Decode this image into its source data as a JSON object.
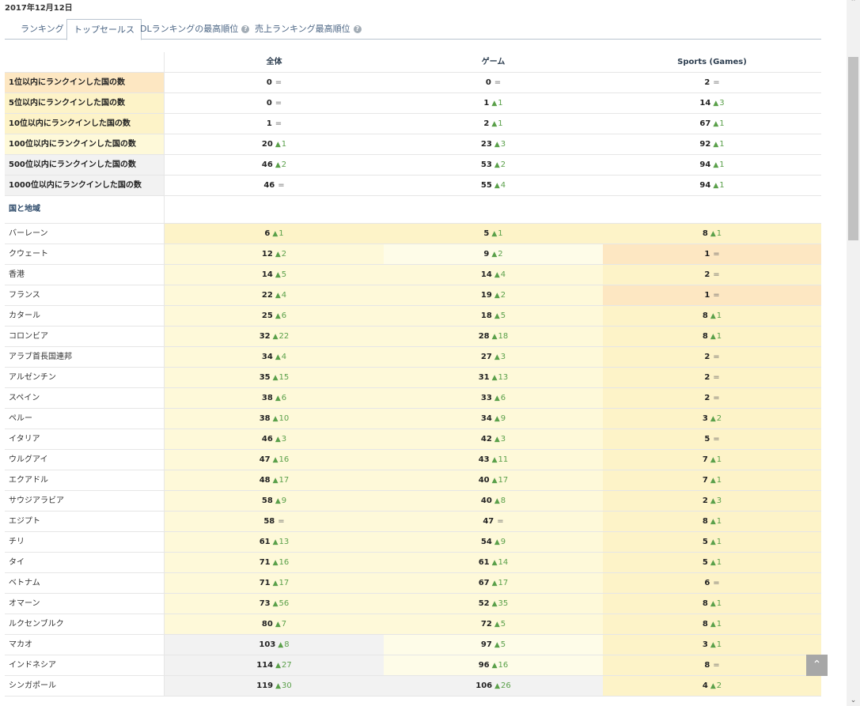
{
  "date": "2017年12月12日",
  "tabs": [
    {
      "label": "ランキング",
      "help": false,
      "active": false
    },
    {
      "label": "トップセールス",
      "help": false,
      "active": true
    },
    {
      "label": "DLランキングの最高順位",
      "help": true,
      "active": false
    },
    {
      "label": "売上ランキング最高順位",
      "help": true,
      "active": false
    }
  ],
  "columns": [
    "全体",
    "ゲーム",
    "Sports (Games)"
  ],
  "summary": [
    {
      "label": "1位以内にランクインした国の数",
      "cells": [
        [
          "0",
          "="
        ],
        [
          "0",
          "="
        ],
        [
          "2",
          "="
        ]
      ]
    },
    {
      "label": "5位以内にランクインした国の数",
      "cells": [
        [
          "0",
          "="
        ],
        [
          "1",
          "1"
        ],
        [
          "14",
          "3"
        ]
      ]
    },
    {
      "label": "10位以内にランクインした国の数",
      "cells": [
        [
          "1",
          "="
        ],
        [
          "2",
          "1"
        ],
        [
          "67",
          "1"
        ]
      ]
    },
    {
      "label": "100位以内にランクインした国の数",
      "cells": [
        [
          "20",
          "1"
        ],
        [
          "23",
          "3"
        ],
        [
          "92",
          "1"
        ]
      ]
    },
    {
      "label": "500位以内にランクインした国の数",
      "cells": [
        [
          "46",
          "2"
        ],
        [
          "53",
          "2"
        ],
        [
          "94",
          "1"
        ]
      ]
    },
    {
      "label": "1000位以内にランクインした国の数",
      "cells": [
        [
          "46",
          "="
        ],
        [
          "55",
          "4"
        ],
        [
          "94",
          "1"
        ]
      ]
    }
  ],
  "section_title": "国と地域",
  "countries": [
    {
      "name": "バーレーン",
      "cells": [
        [
          "6",
          "1"
        ],
        [
          "5",
          "1"
        ],
        [
          "8",
          "1"
        ]
      ]
    },
    {
      "name": "クウェート",
      "cells": [
        [
          "12",
          "2"
        ],
        [
          "9",
          "2"
        ],
        [
          "1",
          "="
        ]
      ]
    },
    {
      "name": "香港",
      "cells": [
        [
          "14",
          "5"
        ],
        [
          "14",
          "4"
        ],
        [
          "2",
          "="
        ]
      ]
    },
    {
      "name": "フランス",
      "cells": [
        [
          "22",
          "4"
        ],
        [
          "19",
          "2"
        ],
        [
          "1",
          "="
        ]
      ]
    },
    {
      "name": "カタール",
      "cells": [
        [
          "25",
          "6"
        ],
        [
          "18",
          "5"
        ],
        [
          "8",
          "1"
        ]
      ]
    },
    {
      "name": "コロンビア",
      "cells": [
        [
          "32",
          "22"
        ],
        [
          "28",
          "18"
        ],
        [
          "8",
          "1"
        ]
      ]
    },
    {
      "name": "アラブ首長国連邦",
      "cells": [
        [
          "34",
          "4"
        ],
        [
          "27",
          "3"
        ],
        [
          "2",
          "="
        ]
      ]
    },
    {
      "name": "アルゼンチン",
      "cells": [
        [
          "35",
          "15"
        ],
        [
          "31",
          "13"
        ],
        [
          "2",
          "="
        ]
      ]
    },
    {
      "name": "スペイン",
      "cells": [
        [
          "38",
          "6"
        ],
        [
          "33",
          "6"
        ],
        [
          "2",
          "="
        ]
      ]
    },
    {
      "name": "ペルー",
      "cells": [
        [
          "38",
          "10"
        ],
        [
          "34",
          "9"
        ],
        [
          "3",
          "2"
        ]
      ]
    },
    {
      "name": "イタリア",
      "cells": [
        [
          "46",
          "3"
        ],
        [
          "42",
          "3"
        ],
        [
          "5",
          "="
        ]
      ]
    },
    {
      "name": "ウルグアイ",
      "cells": [
        [
          "47",
          "16"
        ],
        [
          "43",
          "11"
        ],
        [
          "7",
          "1"
        ]
      ]
    },
    {
      "name": "エクアドル",
      "cells": [
        [
          "48",
          "17"
        ],
        [
          "40",
          "17"
        ],
        [
          "7",
          "1"
        ]
      ]
    },
    {
      "name": "サウジアラビア",
      "cells": [
        [
          "58",
          "9"
        ],
        [
          "40",
          "8"
        ],
        [
          "2",
          "3"
        ]
      ]
    },
    {
      "name": "エジプト",
      "cells": [
        [
          "58",
          "="
        ],
        [
          "47",
          "="
        ],
        [
          "8",
          "1"
        ]
      ]
    },
    {
      "name": "チリ",
      "cells": [
        [
          "61",
          "13"
        ],
        [
          "54",
          "9"
        ],
        [
          "5",
          "1"
        ]
      ]
    },
    {
      "name": "タイ",
      "cells": [
        [
          "71",
          "16"
        ],
        [
          "61",
          "14"
        ],
        [
          "5",
          "1"
        ]
      ]
    },
    {
      "name": "ベトナム",
      "cells": [
        [
          "71",
          "17"
        ],
        [
          "67",
          "17"
        ],
        [
          "6",
          "="
        ]
      ]
    },
    {
      "name": "オマーン",
      "cells": [
        [
          "73",
          "56"
        ],
        [
          "52",
          "35"
        ],
        [
          "8",
          "1"
        ]
      ]
    },
    {
      "name": "ルクセンブルク",
      "cells": [
        [
          "80",
          "7"
        ],
        [
          "72",
          "5"
        ],
        [
          "8",
          "1"
        ]
      ]
    },
    {
      "name": "マカオ",
      "cells": [
        [
          "103",
          "8"
        ],
        [
          "97",
          "5"
        ],
        [
          "3",
          "1"
        ]
      ]
    },
    {
      "name": "インドネシア",
      "cells": [
        [
          "114",
          "27"
        ],
        [
          "96",
          "16"
        ],
        [
          "8",
          "="
        ]
      ]
    },
    {
      "name": "シンガポール",
      "cells": [
        [
          "119",
          "30"
        ],
        [
          "106",
          "26"
        ],
        [
          "4",
          "2"
        ]
      ]
    }
  ],
  "colors": {
    "rank_top": "#fde7c2",
    "rank_high": "#fdf3c8",
    "rank_mid": "#fef9d9",
    "rank_low": "#fefce8",
    "rank_none": "#f2f2f2",
    "up": "#5aa04a"
  },
  "icons": {
    "scroll_up": "chevron-up-icon",
    "scroll_down": "chevron-down-icon",
    "back_to_top": "chevron-up-icon"
  }
}
